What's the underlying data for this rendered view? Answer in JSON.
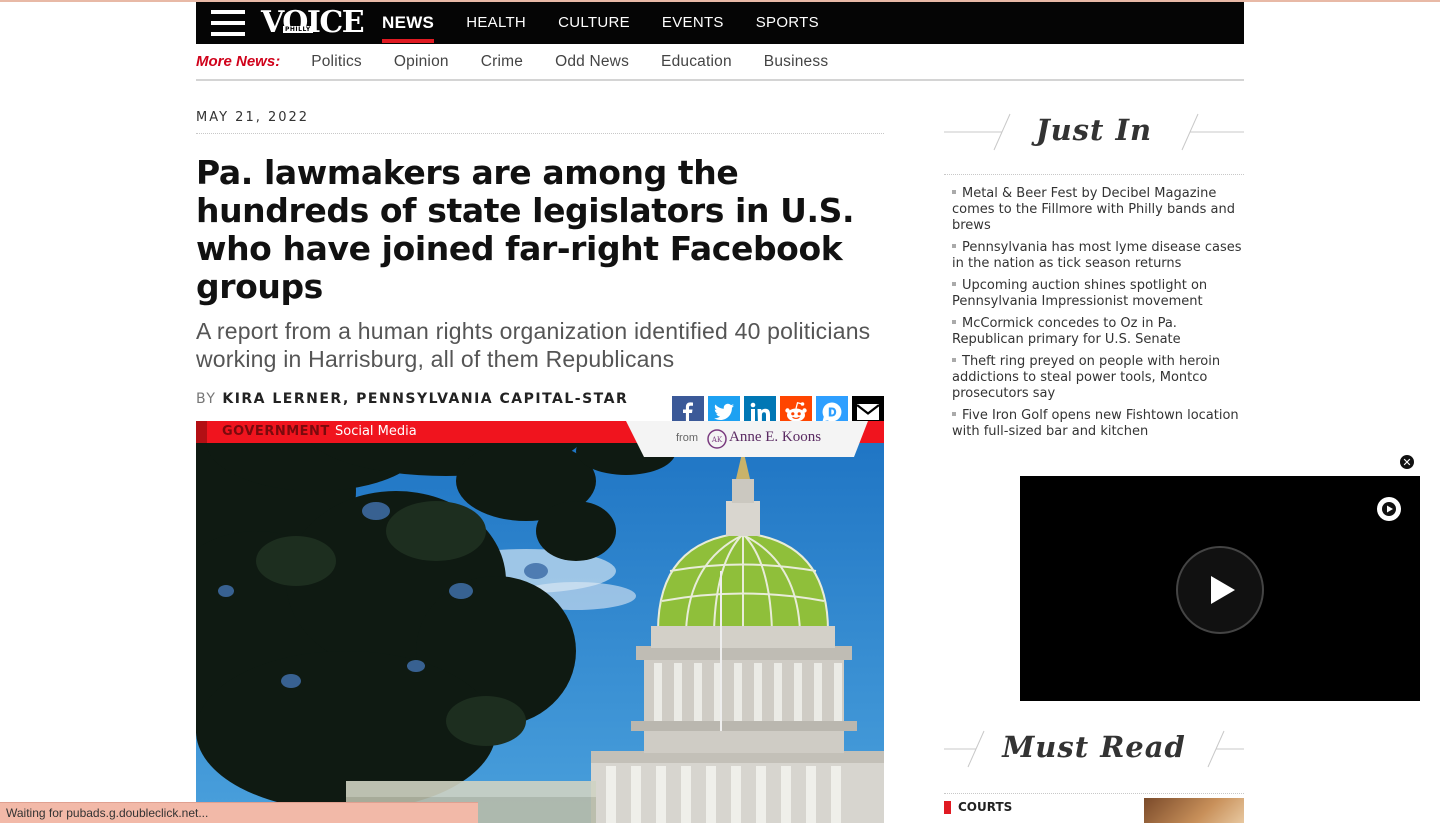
{
  "site": {
    "logo_text": "VOICE",
    "logo_small": "PHILLY"
  },
  "nav": {
    "items": [
      {
        "label": "NEWS",
        "active": true
      },
      {
        "label": "HEALTH",
        "active": false
      },
      {
        "label": "CULTURE",
        "active": false
      },
      {
        "label": "EVENTS",
        "active": false
      },
      {
        "label": "SPORTS",
        "active": false
      }
    ]
  },
  "subnav": {
    "more_label": "More News:",
    "items": [
      "Politics",
      "Opinion",
      "Crime",
      "Odd News",
      "Education",
      "Business"
    ]
  },
  "article": {
    "date": "MAY 21, 2022",
    "headline": "Pa. lawmakers are among the hundreds of state legislators in U.S. who have joined far-right Facebook groups",
    "dek": "A report from a human rights organization identified 40 politicians working in Harrisburg, all of them Republicans",
    "byline_prefix": "BY",
    "byline_name": "KIRA LERNER, PENNSYLVANIA CAPITAL-STAR",
    "share": [
      {
        "icon": "facebook-icon",
        "color": "#3b5998"
      },
      {
        "icon": "twitter-icon",
        "color": "#1da1f2"
      },
      {
        "icon": "linkedin-icon",
        "color": "#0077b5"
      },
      {
        "icon": "reddit-icon",
        "color": "#ff4500"
      },
      {
        "icon": "disqus-icon",
        "color": "#2e9fff"
      },
      {
        "icon": "email-icon",
        "color": "#000000"
      }
    ]
  },
  "hero": {
    "section_tag": "GOVERNMENT",
    "topic_tag": "Social Media",
    "sponsor_from": "from",
    "sponsor_name": "Anne E. Koons"
  },
  "sidebar": {
    "just_in_title": "Just In",
    "just_in": [
      "Metal & Beer Fest by Decibel Magazine comes to the Fillmore with Philly bands and brews",
      "Pennsylvania has most lyme disease cases in the nation as tick season returns",
      "Upcoming auction shines spotlight on Pennsylvania Impressionist movement",
      "McCormick concedes to Oz in Pa. Republican primary for U.S. Senate",
      "Theft ring preyed on people with heroin addictions to steal power tools, Montco prosecutors say",
      "Five Iron Golf opens new Fishtown location with full-sized bar and kitchen"
    ],
    "must_read_title": "Must Read",
    "must_read_category": "COURTS"
  },
  "video": {
    "close_label": "✕"
  },
  "status": {
    "text": "Waiting for pubads.g.doubleclick.net..."
  },
  "colors": {
    "accent_red": "#e01a22",
    "nav_bg": "#050505",
    "status_bg": "#f2b9a8"
  }
}
